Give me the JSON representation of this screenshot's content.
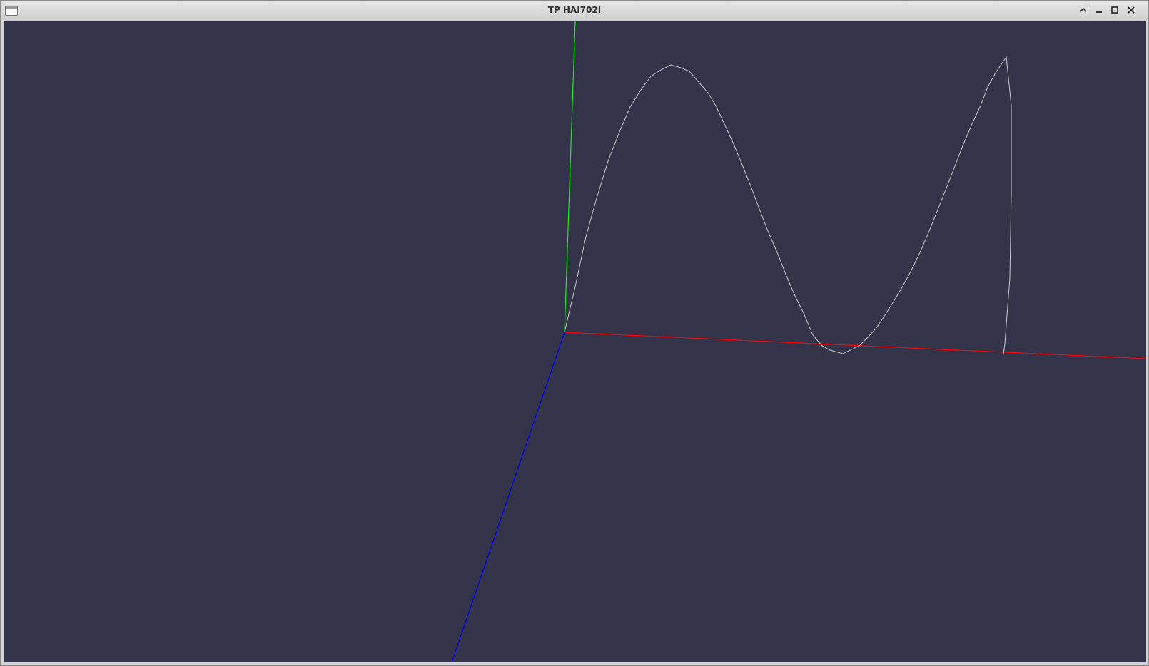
{
  "window": {
    "title": "TP HAI702I",
    "buttons": [
      "menu-icon",
      "shade-icon",
      "minimize-icon",
      "maximize-icon",
      "close-icon"
    ]
  },
  "scene": {
    "background_color": "#33334a",
    "axes": [
      {
        "name": "x-axis",
        "color": "#ff0000"
      },
      {
        "name": "y-axis",
        "color": "#00ff00"
      },
      {
        "name": "z-axis",
        "color": "#0000ff"
      }
    ],
    "curve_color": "#c8c8c8"
  }
}
